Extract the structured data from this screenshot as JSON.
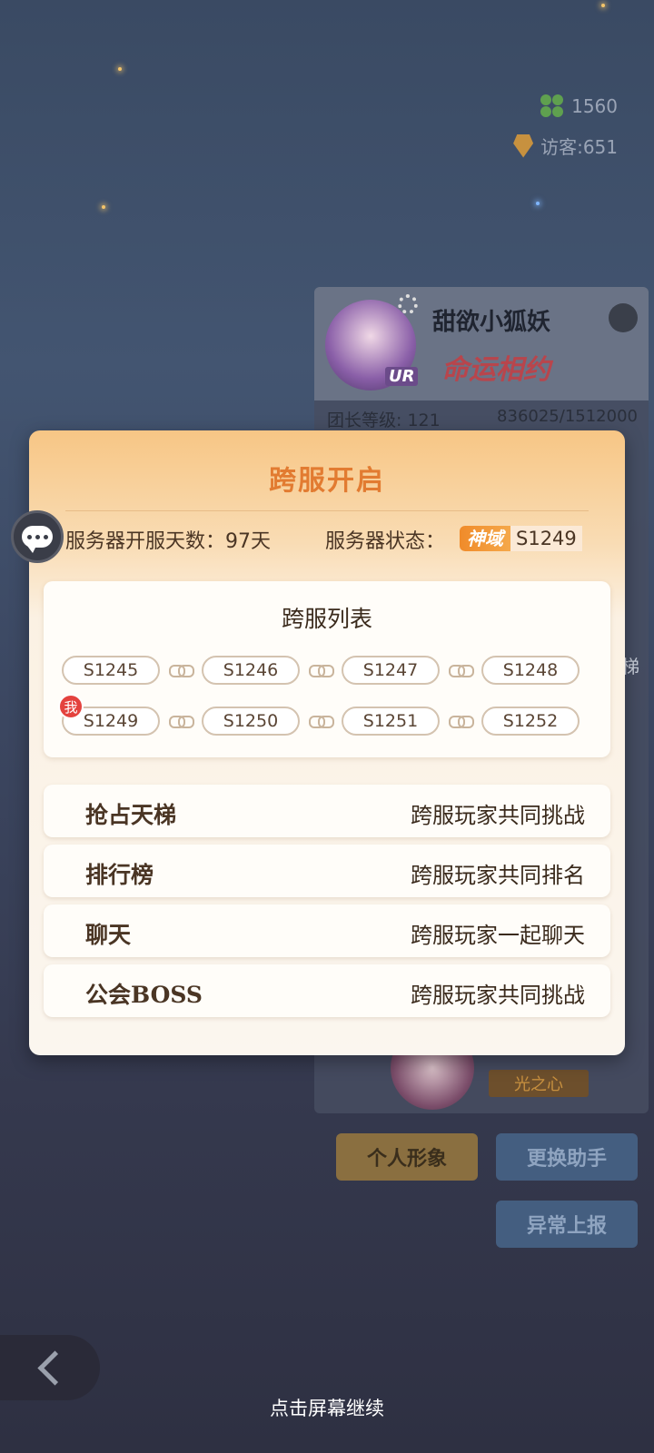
{
  "stats": {
    "clover_count": "1560",
    "visitors": "访客:651"
  },
  "profile": {
    "name": "甜欲小狐妖",
    "rarity": "UR",
    "badge": "命运相约",
    "level": "团长等级: 121",
    "exp": "836025/1512000",
    "heart_tag": "光之心",
    "side_text": "梯"
  },
  "buttons": {
    "personal_image": "个人形象",
    "change_helper": "更换助手",
    "report": "异常上报"
  },
  "modal": {
    "title": "跨服开启",
    "open_days": "服务器开服天数：97天",
    "status_label": "服务器状态：",
    "status_tag": "神域",
    "status_server": "S1249",
    "list_title": "跨服列表",
    "me_badge": "我",
    "servers": [
      [
        "S1245",
        "S1246",
        "S1247",
        "S1248"
      ],
      [
        "S1249",
        "S1250",
        "S1251",
        "S1252"
      ]
    ],
    "features": [
      {
        "name": "抢占天梯",
        "desc": "跨服玩家共同挑战"
      },
      {
        "name": "排行榜",
        "desc": "跨服玩家共同排名"
      },
      {
        "name": "聊天",
        "desc": "跨服玩家一起聊天"
      },
      {
        "name": "公会BOSS",
        "desc": "跨服玩家共同挑战"
      }
    ]
  },
  "continue_hint": "点击屏幕继续"
}
